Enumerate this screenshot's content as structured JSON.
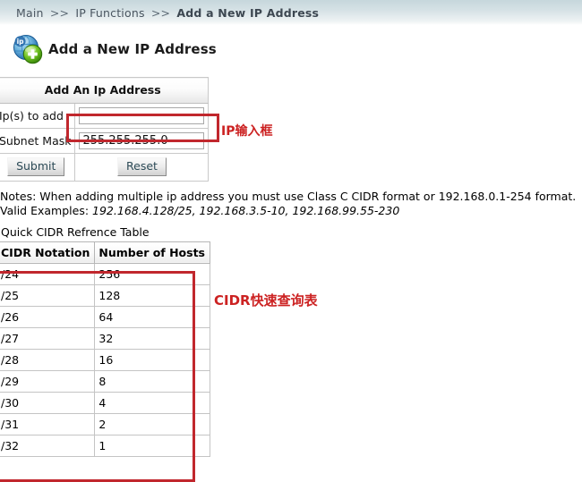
{
  "breadcrumb": {
    "items": [
      "Main",
      "IP Functions",
      "Add a New IP Address"
    ],
    "separator": ">>"
  },
  "page": {
    "title": "Add a New IP Address",
    "icon": "ip-globe-add-icon",
    "icon_badge_text": "ip"
  },
  "form": {
    "caption": "Add An Ip Address",
    "fields": [
      {
        "label": "Ip(s) to add",
        "value": "",
        "placeholder": ""
      },
      {
        "label": "Subnet Mask",
        "value": "255.255.255.0",
        "placeholder": ""
      }
    ],
    "submit_label": "Submit",
    "reset_label": "Reset"
  },
  "notes": {
    "line1": "Notes: When adding multiple ip address you must use Class C CIDR format or 192.168.0.1-254 format.",
    "line2_label": "Valid Examples: ",
    "line2_examples": "192.168.4.128/25, 192.168.3.5-10, 192.168.99.55-230"
  },
  "cidr_table": {
    "title": "Quick CIDR Refrence Table",
    "columns": [
      "CIDR Notation",
      "Number of Hosts"
    ],
    "rows": [
      [
        "/24",
        "256"
      ],
      [
        "/25",
        "128"
      ],
      [
        "/26",
        "64"
      ],
      [
        "/27",
        "32"
      ],
      [
        "/28",
        "16"
      ],
      [
        "/29",
        "8"
      ],
      [
        "/30",
        "4"
      ],
      [
        "/31",
        "2"
      ],
      [
        "/32",
        "1"
      ]
    ]
  },
  "annotations": {
    "ip_input": "IP输入框",
    "cidr_table": "CIDR快速查询表",
    "color": "#cc2222"
  }
}
